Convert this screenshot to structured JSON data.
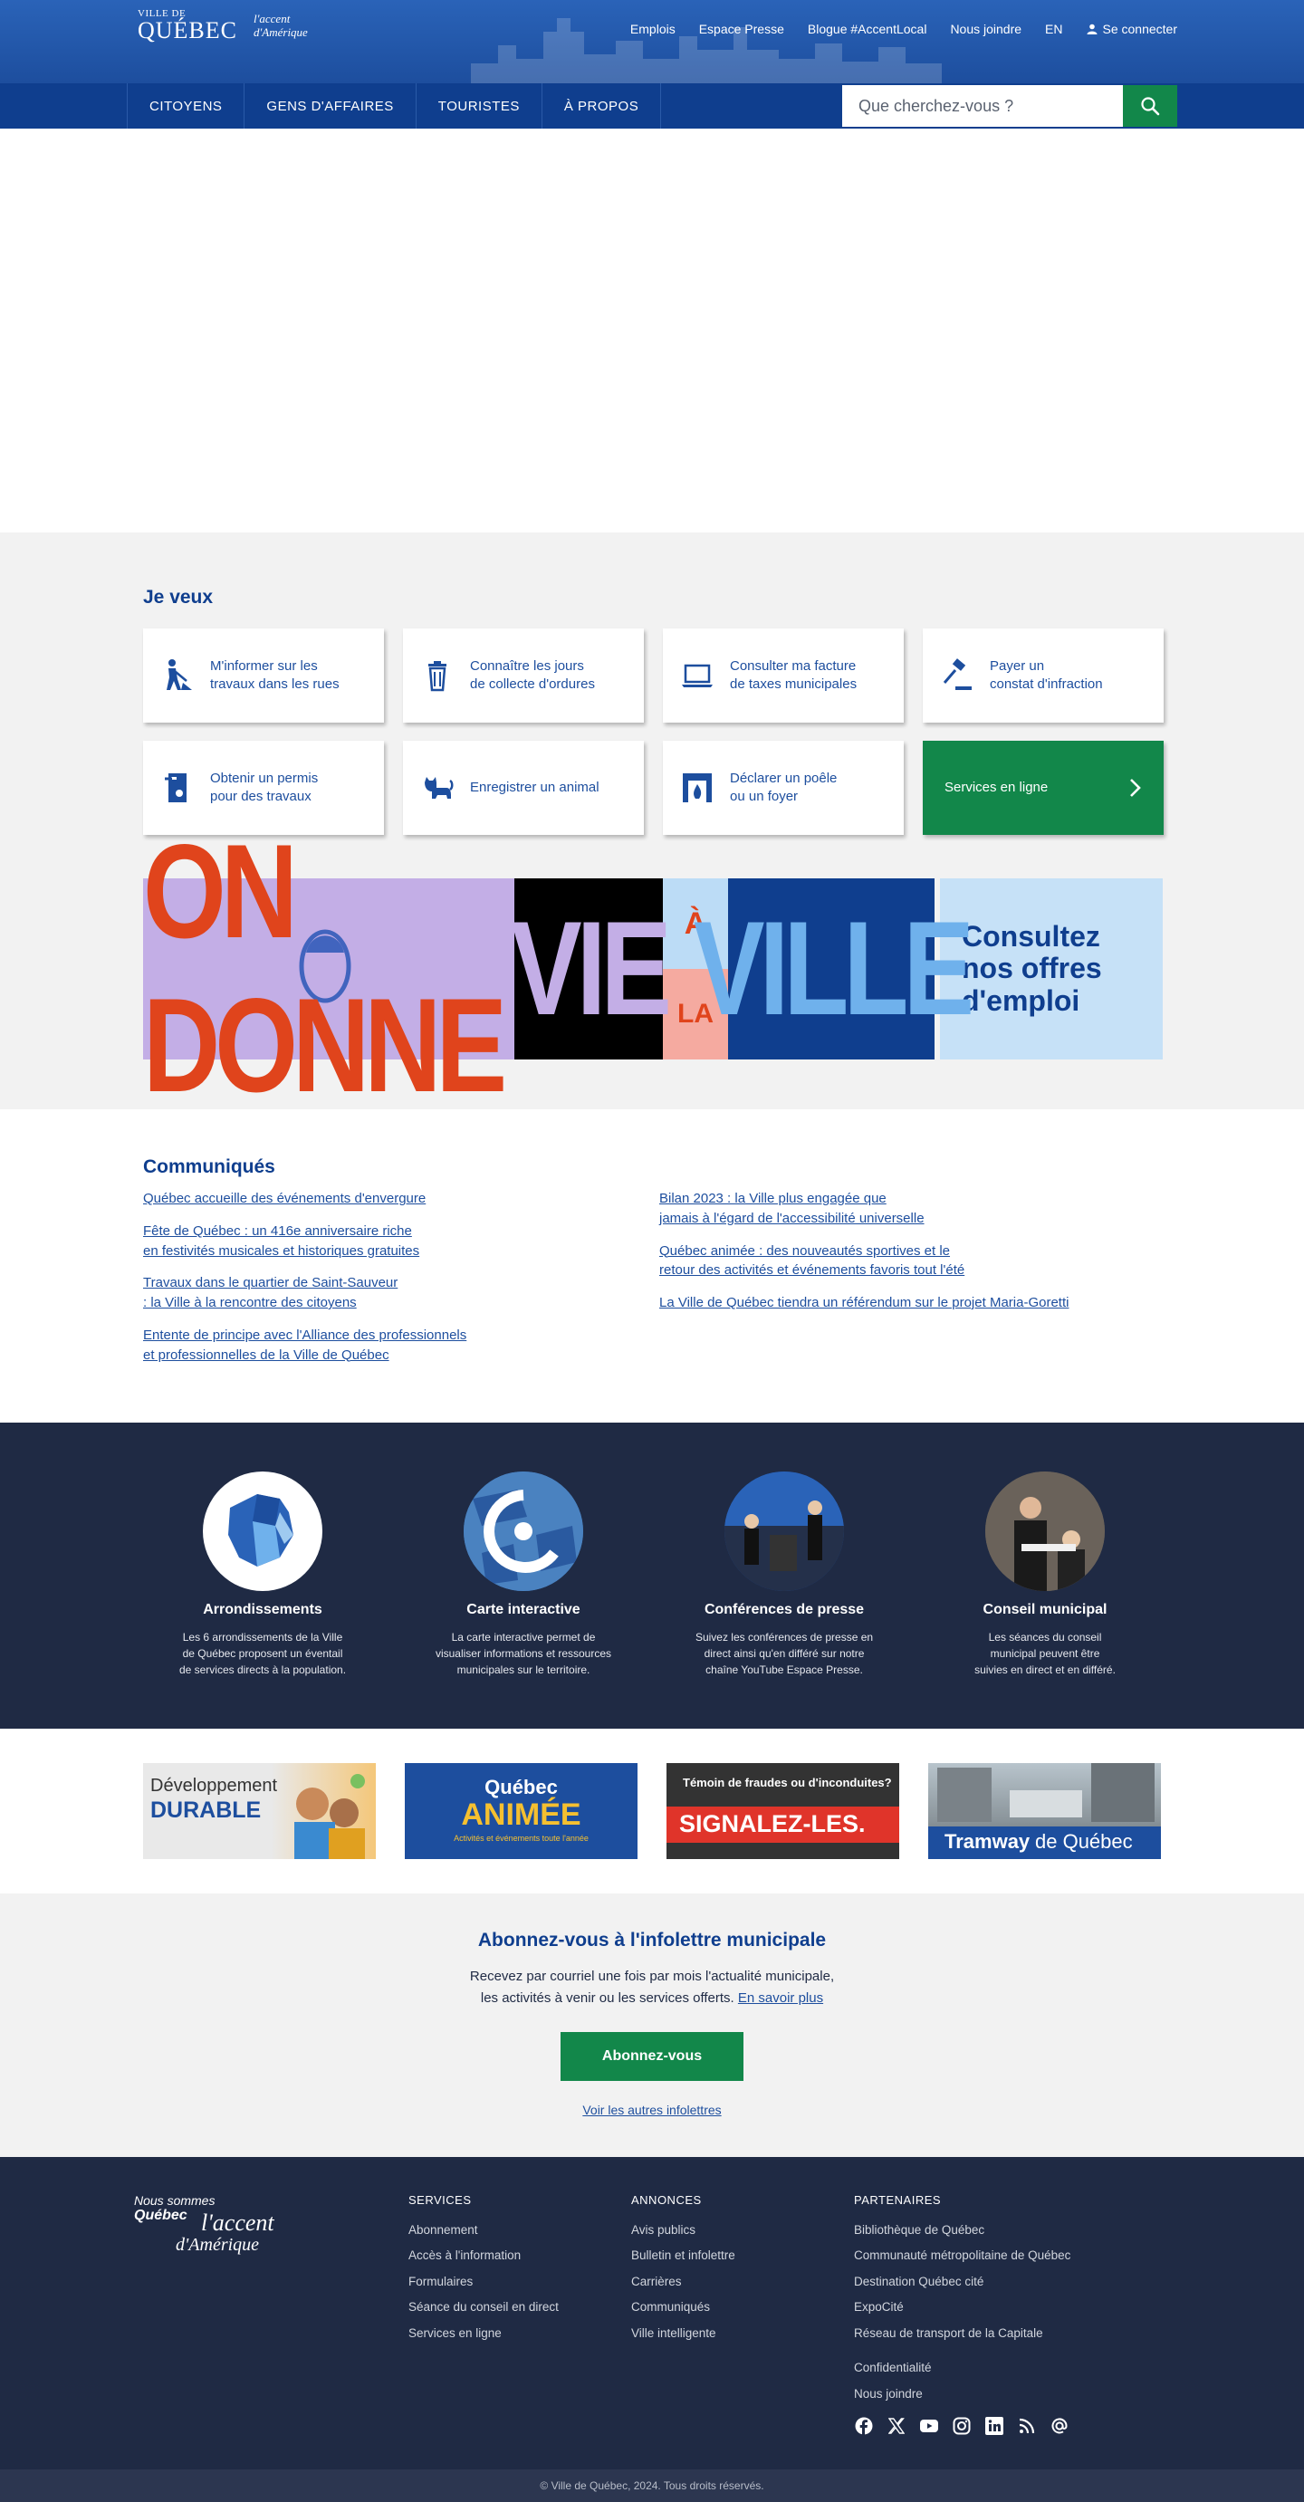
{
  "header": {
    "brand_small": "VILLE DE",
    "brand_big": "QUÉBEC",
    "brand_accent_line1": "l'accent",
    "brand_accent_line2": "d'Amérique",
    "top_links": [
      "Emplois",
      "Espace Presse",
      "Blogue #AccentLocal",
      "Nous joindre",
      "EN"
    ],
    "login_label": "Se connecter"
  },
  "nav": {
    "items": [
      "CITOYENS",
      "GENS D'AFFAIRES",
      "TOURISTES",
      "À PROPOS"
    ],
    "search_placeholder": "Que cherchez-vous ?"
  },
  "jeveux": {
    "title": "Je veux",
    "tiles": [
      {
        "label": "M'informer sur les\ntravaux dans les rues",
        "icon": "roadwork-icon"
      },
      {
        "label": "Connaître les jours\nde collecte d'ordures",
        "icon": "trash-icon"
      },
      {
        "label": "Consulter ma facture\nde taxes municipales",
        "icon": "laptop-icon"
      },
      {
        "label": "Payer un\nconstat d'infraction",
        "icon": "gavel-icon"
      },
      {
        "label": "Obtenir un permis\npour des travaux",
        "icon": "permit-icon"
      },
      {
        "label": "Enregistrer un animal",
        "icon": "cat-icon"
      },
      {
        "label": "Déclarer un poêle\nou un foyer",
        "icon": "fireplace-icon"
      }
    ],
    "online_services": "Services en ligne"
  },
  "banner": {
    "part1": "ON DONNE",
    "part2": "VIE",
    "part3_top": "À",
    "part3_bottom": "LA",
    "part4": "VILLE",
    "cta": "Consultez\nnos offres\nd'emploi"
  },
  "communiques": {
    "title": "Communiqués",
    "left": [
      "Québec accueille des événements d'envergure",
      "Fête de Québec : un 416e anniversaire riche\nen festivités musicales et historiques gratuites",
      "Travaux dans le quartier de Saint-Sauveur\n: la Ville à la rencontre des citoyens",
      "Entente de principe avec l'Alliance des professionnels\net professionnelles de la Ville de Québec"
    ],
    "right": [
      "Bilan 2023 : la Ville plus engagée que\njamais à l'égard de l'accessibilité universelle",
      "Québec animée : des nouveautés sportives et le\nretour des activités et événements favoris tout l'été",
      "La Ville de Québec tiendra un référendum sur le projet Maria-Goretti"
    ]
  },
  "features": [
    {
      "title": "Arrondissements",
      "text": "Les 6 arrondissements de la Ville\nde Québec proposent un éventail\nde services directs à la population."
    },
    {
      "title": "Carte interactive",
      "text": "La carte interactive permet de\nvisualiser informations et ressources\nmunicipales sur le territoire."
    },
    {
      "title": "Conférences de presse",
      "text": "Suivez les conférences de presse en\ndirect ainsi qu'en différé sur notre\nchaîne YouTube Espace Presse."
    },
    {
      "title": "Conseil municipal",
      "text": "Les séances du conseil\nmunicipal peuvent être\nsuivies en direct et en différé."
    }
  ],
  "promos": {
    "p1_line1": "Développement",
    "p1_line2": "DURABLE",
    "p2_line1": "Québec",
    "p2_line2": "ANIMÉE",
    "p2_line3": "Activités et événements toute l'année",
    "p3_line1": "Témoin de fraudes ou d'inconduites?",
    "p3_line2": "SIGNALEZ-LES.",
    "p4_line1": "Tramway",
    "p4_line2": "de Québec"
  },
  "newsletter": {
    "title": "Abonnez-vous à l'infolettre municipale",
    "text": "Recevez par courriel une fois par mois l'actualité municipale,\nles activités à venir ou les services offerts.",
    "more_link": "En savoir plus",
    "button": "Abonnez-vous",
    "other": "Voir les autres infolettres"
  },
  "footer": {
    "logo_line1": "Nous sommes",
    "logo_line2": "Québec",
    "logo_line3": "l'accent",
    "logo_line4": "d'Amérique",
    "services_title": "SERVICES",
    "services": [
      "Abonnement",
      "Accès à l'information",
      "Formulaires",
      "Séance du conseil en direct",
      "Services en ligne"
    ],
    "annonces_title": "ANNONCES",
    "annonces": [
      "Avis publics",
      "Bulletin et infolettre",
      "Carrières",
      "Communiqués",
      "Ville intelligente"
    ],
    "partenaires_title": "PARTENAIRES",
    "partenaires": [
      "Bibliothèque de Québec",
      "Communauté métropolitaine de Québec",
      "Destination Québec cité",
      "ExpoCité",
      "Réseau de transport de la Capitale"
    ],
    "extra": [
      "Confidentialité",
      "Nous joindre"
    ],
    "copyright": "© Ville de Québec, 2024. Tous droits réservés."
  },
  "colors": {
    "primary_blue": "#0f3e8e",
    "header_blue": "#2a63b8",
    "green": "#12874a",
    "dark_navy": "#1f2a44"
  }
}
